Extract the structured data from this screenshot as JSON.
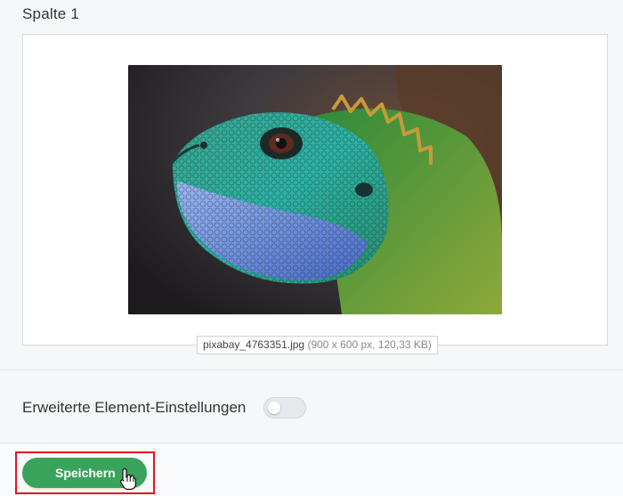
{
  "column": {
    "title": "Spalte 1",
    "image": {
      "alt": "Grüne Wasseragame (Leguan) Nahaufnahme",
      "file_name": "pixabay_4763351.jpg",
      "file_meta": "(900 x 600 px, 120,33 KB)"
    }
  },
  "advanced": {
    "label": "Erweiterte Element-Einstellungen",
    "toggle_on": false
  },
  "actions": {
    "save_label": "Speichern"
  },
  "colors": {
    "save_button": "#3aa35b",
    "highlight": "#e0141f"
  },
  "icons": {
    "cursor": "hand-pointer-icon"
  }
}
